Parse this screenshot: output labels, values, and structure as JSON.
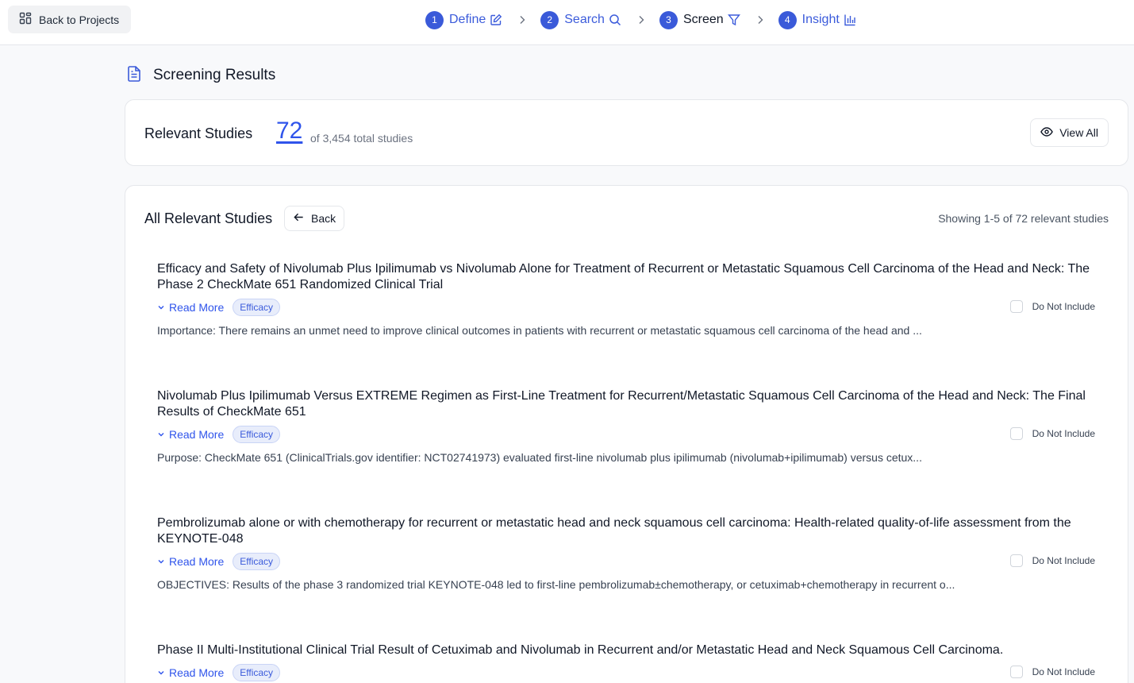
{
  "topbar": {
    "back_label": "Back to Projects",
    "steps": [
      {
        "num": "1",
        "label": "Define",
        "icon": "edit-icon"
      },
      {
        "num": "2",
        "label": "Search",
        "icon": "search-icon"
      },
      {
        "num": "3",
        "label": "Screen",
        "icon": "filter-icon"
      },
      {
        "num": "4",
        "label": "Insight",
        "icon": "bar-chart-icon"
      }
    ],
    "active_step": 3
  },
  "page": {
    "title": "Screening Results",
    "icon": "document-icon"
  },
  "summary": {
    "label": "Relevant Studies",
    "count": "72",
    "total_text": "of 3,454 total studies",
    "view_all_label": "View All"
  },
  "list": {
    "title": "All Relevant Studies",
    "back_label": "Back",
    "showing_text": "Showing 1-5 of 72 relevant studies",
    "read_more_label": "Read More",
    "exclude_label": "Do Not Include",
    "studies": [
      {
        "title": "Efficacy and Safety of Nivolumab Plus Ipilimumab vs Nivolumab Alone for Treatment of Recurrent or Metastatic Squamous Cell Carcinoma of the Head and Neck: The Phase 2 CheckMate 651 Randomized Clinical Trial",
        "tag": "Efficacy",
        "abstract": "Importance: There remains an unmet need to improve clinical outcomes in patients with recurrent or metastatic squamous cell carcinoma of the head and ..."
      },
      {
        "title": "Nivolumab Plus Ipilimumab Versus EXTREME Regimen as First-Line Treatment for Recurrent/Metastatic Squamous Cell Carcinoma of the Head and Neck: The Final Results of CheckMate 651",
        "tag": "Efficacy",
        "abstract": "Purpose: CheckMate 651 (ClinicalTrials.gov identifier: NCT02741973) evaluated first-line nivolumab plus ipilimumab (nivolumab+ipilimumab) versus cetux..."
      },
      {
        "title": "Pembrolizumab alone or with chemotherapy for recurrent or metastatic head and neck squamous cell carcinoma: Health-related quality-of-life assessment from the KEYNOTE-048",
        "tag": "Efficacy",
        "abstract": "OBJECTIVES: Results of the phase 3 randomized trial KEYNOTE-048 led to first-line pembrolizumab±chemotherapy, or cetuximab+chemotherapy in recurrent o..."
      },
      {
        "title": "Phase II Multi-Institutional Clinical Trial Result of Cetuximab and Nivolumab in Recurrent and/or Metastatic Head and Neck Squamous Cell Carcinoma.",
        "tag": "Efficacy",
        "abstract": ""
      }
    ]
  },
  "colors": {
    "accent": "#3a5ad9",
    "link": "#2f54eb",
    "tag_bg": "#e8edfb"
  }
}
